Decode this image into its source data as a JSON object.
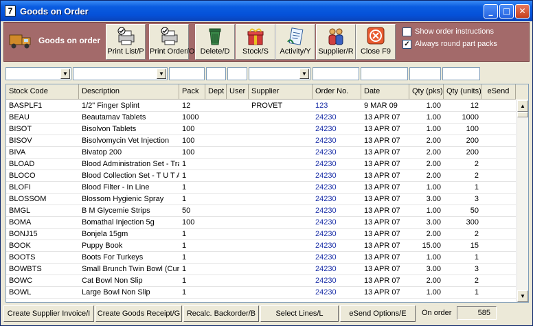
{
  "window": {
    "title": "Goods on Order",
    "app_glyph": "7"
  },
  "toolbar": {
    "brand": "Goods on order",
    "buttons": [
      {
        "label": "Print List/P"
      },
      {
        "label": "Print Order/O"
      },
      {
        "label": "Delete/D"
      },
      {
        "label": "Stock/S"
      },
      {
        "label": "Activity/Y"
      },
      {
        "label": "Supplier/R"
      },
      {
        "label": "Close F9"
      }
    ],
    "checkboxes": [
      {
        "label": "Show order instructions",
        "checked": false
      },
      {
        "label": "Always round part packs",
        "checked": true
      }
    ]
  },
  "columns": [
    "Stock Code",
    "Description",
    "Pack",
    "Dept",
    "User",
    "Supplier",
    "Order No.",
    "Date",
    "Qty (pks)",
    "Qty (units)",
    "eSend"
  ],
  "rows": [
    [
      "BASPLF1",
      "1/2\" Finger Splint",
      "12",
      "",
      "",
      "PROVET",
      "123",
      "9 MAR 09",
      "1.00",
      "12",
      ""
    ],
    [
      "BEAU",
      "Beautamav Tablets",
      "1000",
      "",
      "",
      "",
      "24230",
      "13 APR 07",
      "1.00",
      "1000",
      ""
    ],
    [
      "BISOT",
      "Bisolvon Tablets",
      "100",
      "",
      "",
      "",
      "24230",
      "13 APR 07",
      "1.00",
      "100",
      ""
    ],
    [
      "BISOV",
      "Bisolvomycin Vet Injection",
      "100",
      "",
      "",
      "",
      "24230",
      "13 APR 07",
      "2.00",
      "200",
      ""
    ],
    [
      "BIVA",
      "Bivatop 200",
      "100",
      "",
      "",
      "",
      "24230",
      "13 APR 07",
      "2.00",
      "200",
      ""
    ],
    [
      "BLOAD",
      "Blood Administration Set - Tra",
      "1",
      "",
      "",
      "",
      "24230",
      "13 APR 07",
      "2.00",
      "2",
      ""
    ],
    [
      "BLOCO",
      "Blood Collection Set - T U T A",
      "1",
      "",
      "",
      "",
      "24230",
      "13 APR 07",
      "2.00",
      "2",
      ""
    ],
    [
      "BLOFI",
      "Blood Filter - In Line",
      "1",
      "",
      "",
      "",
      "24230",
      "13 APR 07",
      "1.00",
      "1",
      ""
    ],
    [
      "BLOSSOM",
      "Blossom Hygienic Spray",
      "1",
      "",
      "",
      "",
      "24230",
      "13 APR 07",
      "3.00",
      "3",
      ""
    ],
    [
      "BMGL",
      "B M Glycemie Strips",
      "50",
      "",
      "",
      "",
      "24230",
      "13 APR 07",
      "1.00",
      "50",
      ""
    ],
    [
      "BOMA",
      "Bomathal Injection 5g",
      "100",
      "",
      "",
      "",
      "24230",
      "13 APR 07",
      "3.00",
      "300",
      ""
    ],
    [
      "BONJ15",
      "Bonjela 15gm",
      "1",
      "",
      "",
      "",
      "24230",
      "13 APR 07",
      "2.00",
      "2",
      ""
    ],
    [
      "BOOK",
      "Puppy Book",
      "1",
      "",
      "",
      "",
      "24230",
      "13 APR 07",
      "15.00",
      "15",
      ""
    ],
    [
      "BOOTS",
      "Boots For Turkeys",
      "1",
      "",
      "",
      "",
      "24230",
      "13 APR 07",
      "1.00",
      "1",
      ""
    ],
    [
      "BOWBTS",
      "Small Brunch Twin Bowl (Cur",
      "1",
      "",
      "",
      "",
      "24230",
      "13 APR 07",
      "3.00",
      "3",
      ""
    ],
    [
      "BOWC",
      "Cat Bowl Non Slip",
      "1",
      "",
      "",
      "",
      "24230",
      "13 APR 07",
      "2.00",
      "2",
      ""
    ],
    [
      "BOWL",
      "Large Bowl Non Slip",
      "1",
      "",
      "",
      "",
      "24230",
      "13 APR 07",
      "1.00",
      "1",
      ""
    ]
  ],
  "bottom": {
    "buttons": [
      {
        "label": "Create Supplier Invoice/I"
      },
      {
        "label": "Create Goods Receipt/G"
      },
      {
        "label": "Recalc. Backorder/B"
      },
      {
        "label": "Select Lines/L"
      },
      {
        "label": "eSend Options/E"
      }
    ],
    "on_order_label": "On order",
    "on_order_value": "585"
  },
  "colors": {
    "toolbar_bg": "#a36a6a",
    "titlebar": "#0551d8",
    "order_no": "#1a2fa8"
  }
}
